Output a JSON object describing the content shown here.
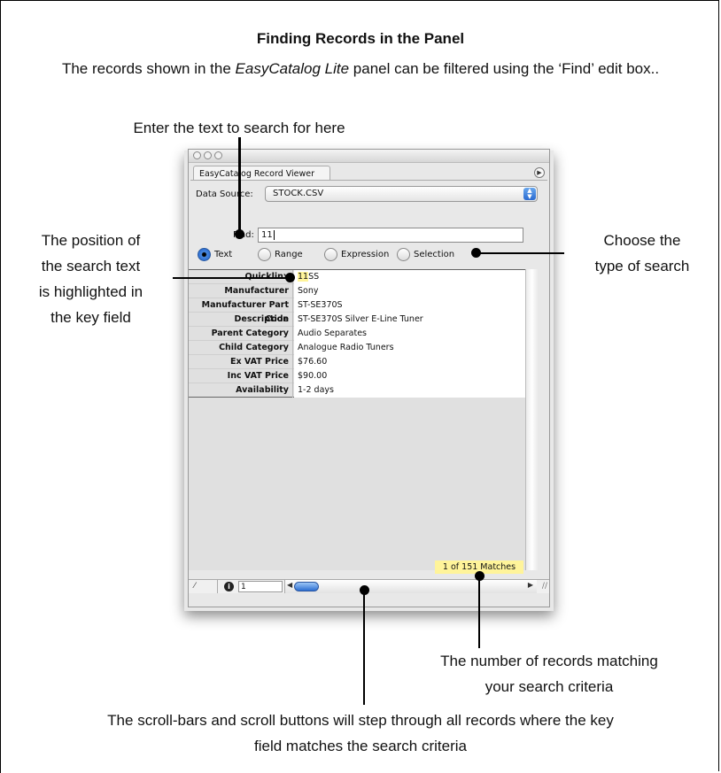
{
  "page": {
    "title": "Finding Records in the Panel",
    "intro_part1": "The records shown in the ",
    "intro_italic": "EasyCatalog Lite",
    "intro_part2": " panel can be filtered using the ‘Find’ edit box.."
  },
  "annotations": {
    "enter_text": "Enter the text to search for here",
    "position_line1": "The position of",
    "position_line2": "the search text",
    "position_line3": "is highlighted in",
    "position_line4": "the key field",
    "choose_line1": "Choose the",
    "choose_line2": "type of search",
    "number_line1": "The number of records matching",
    "number_line2": "your search criteria",
    "scroll_line1": "The scroll-bars and scroll buttons will step through all records where the key",
    "scroll_line2": "field matches the search criteria"
  },
  "panel": {
    "tab_label": "EasyCatalog Record Viewer",
    "data_source_label": "Data Source:",
    "data_source_value": "STOCK.CSV",
    "find_label": "Find:",
    "find_value": "11",
    "search_types": [
      {
        "label": "Text",
        "selected": true
      },
      {
        "label": "Range",
        "selected": false
      },
      {
        "label": "Expression",
        "selected": false
      },
      {
        "label": "Selection",
        "selected": false
      }
    ],
    "fields": [
      {
        "key": "Quicklinx",
        "value_hl": "11",
        "value": "SS"
      },
      {
        "key": "Manufacturer",
        "value": "Sony"
      },
      {
        "key": "Manufacturer Part Code",
        "value": "ST-SE370S"
      },
      {
        "key": "Description",
        "value": "ST-SE370S Silver E-Line Tuner"
      },
      {
        "key": "Parent Category",
        "value": "Audio Separates"
      },
      {
        "key": "Child Category",
        "value": "Analogue Radio Tuners"
      },
      {
        "key": "Ex VAT Price",
        "value": "$76.60"
      },
      {
        "key": "Inc VAT Price",
        "value": "$90.00"
      },
      {
        "key": "Availability",
        "value": "1-2 days"
      }
    ],
    "matches_text": "1 of 151 Matches",
    "record_number": "1",
    "highlight_color": "#fff49a",
    "accent_color": "#2a6ad0"
  }
}
